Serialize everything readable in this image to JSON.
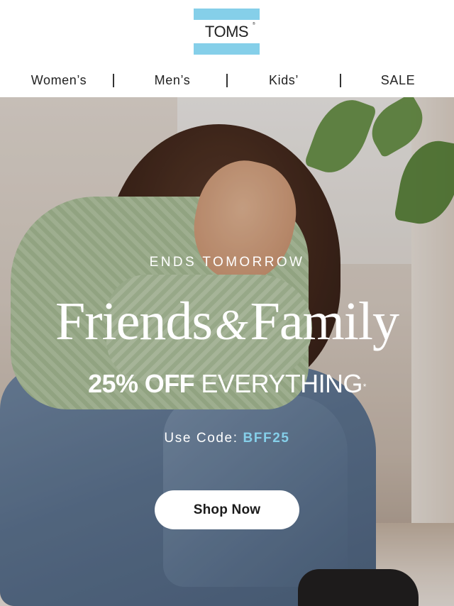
{
  "brand": {
    "logo_text": "TOMS",
    "logo_mark": "®",
    "accent_color": "#85cfe9"
  },
  "nav": {
    "items": [
      {
        "label": "Women’s"
      },
      {
        "label": "Men’s"
      },
      {
        "label": "Kids’"
      },
      {
        "label": "SALE"
      }
    ]
  },
  "hero": {
    "eyebrow": "ENDS TOMORROW",
    "headline_part1": "Friends",
    "headline_amp": "&",
    "headline_part2": "Family",
    "offer_bold": "25% OFF",
    "offer_light": "EVERYTHING",
    "offer_mark": "*",
    "code_label": "Use Code:",
    "code_value": "BFF25",
    "cta_label": "Shop Now"
  }
}
